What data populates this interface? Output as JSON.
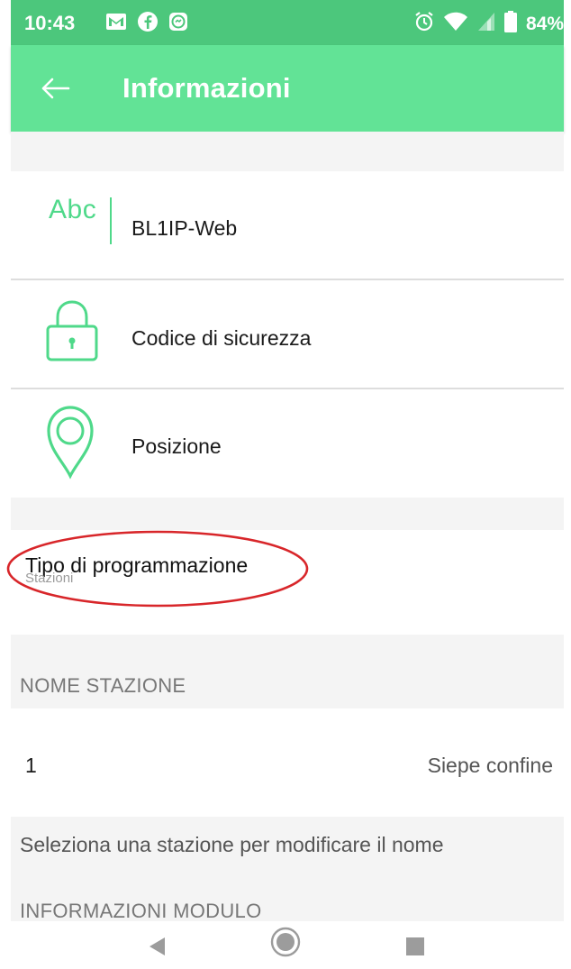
{
  "status_bar": {
    "time": "10:43",
    "battery_percent": "84%",
    "left_icons": [
      "gmail-icon",
      "facebook-icon",
      "messenger-icon"
    ],
    "right_icons": [
      "alarm-icon",
      "wifi-icon",
      "signal-icon",
      "battery-icon"
    ],
    "color": "#4cc77c"
  },
  "app_bar": {
    "title": "Informazioni",
    "back_icon": "back-arrow-icon",
    "color": "#62e396"
  },
  "info_rows": [
    {
      "icon": "abc-text-icon",
      "icon_text": "Abc",
      "label": "BL1IP-Web"
    },
    {
      "icon": "lock-icon",
      "label": "Codice di sicurezza"
    },
    {
      "icon": "location-pin-icon",
      "label": "Posizione"
    }
  ],
  "programming": {
    "title": "Tipo di programmazione",
    "value": "Stazioni",
    "annotation_color": "#d8262a"
  },
  "stations": {
    "header": "NOME STAZIONE",
    "items": [
      {
        "number": "1",
        "name": "Siepe confine"
      }
    ],
    "hint": "Seleziona una stazione per modificare il nome"
  },
  "module_section": {
    "header": "INFORMAZIONI MODULO"
  },
  "nav_bar": {
    "icons": [
      "nav-back-icon",
      "nav-home-icon",
      "nav-recents-icon"
    ]
  },
  "accent_color": "#4fd98a"
}
